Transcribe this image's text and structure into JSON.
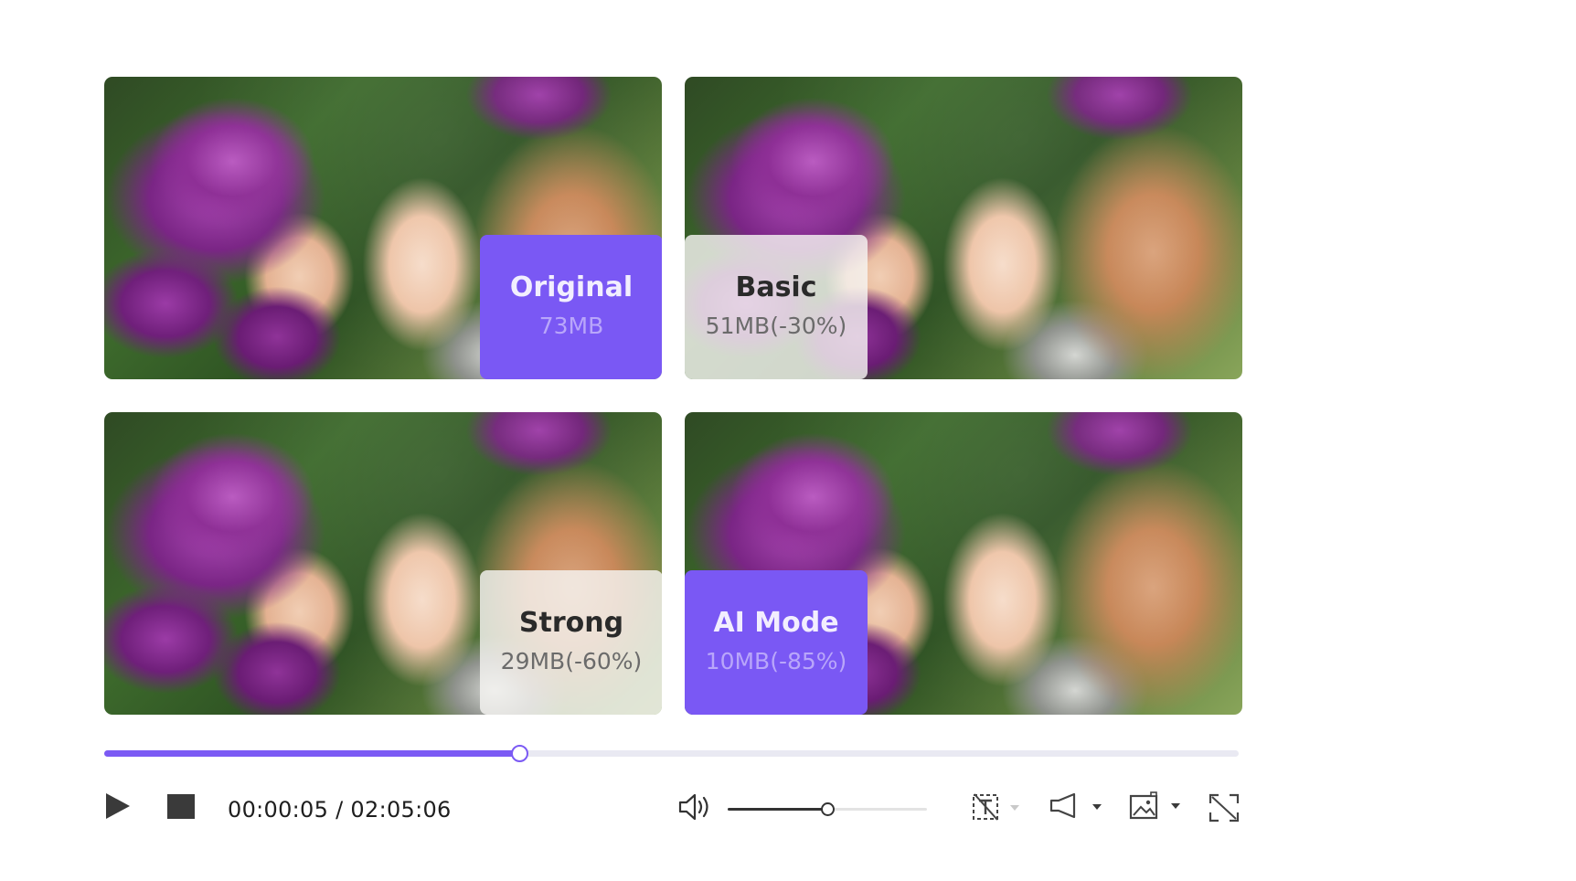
{
  "tiles": [
    {
      "name": "Original",
      "size": "73MB"
    },
    {
      "name": "Basic",
      "size": "51MB(-30%)"
    },
    {
      "name": "Strong",
      "size": "29MB(-60%)"
    },
    {
      "name": "AI Mode",
      "size": "10MB(-85%)"
    }
  ],
  "player": {
    "time_display": "00:00:05 / 02:05:06",
    "progress_fraction": 0.366,
    "volume_fraction": 0.5
  },
  "colors": {
    "accent": "#7b5af4",
    "label_violet": "#7a58f4",
    "track": "#e9e9f2"
  },
  "icons": {
    "play": "play-icon",
    "stop": "stop-icon",
    "volume": "speaker-icon",
    "no_watermark": "watermark-off-icon",
    "audio_track": "speaker-track-icon",
    "snapshot": "image-snapshot-icon",
    "fullscreen": "fullscreen-icon"
  }
}
